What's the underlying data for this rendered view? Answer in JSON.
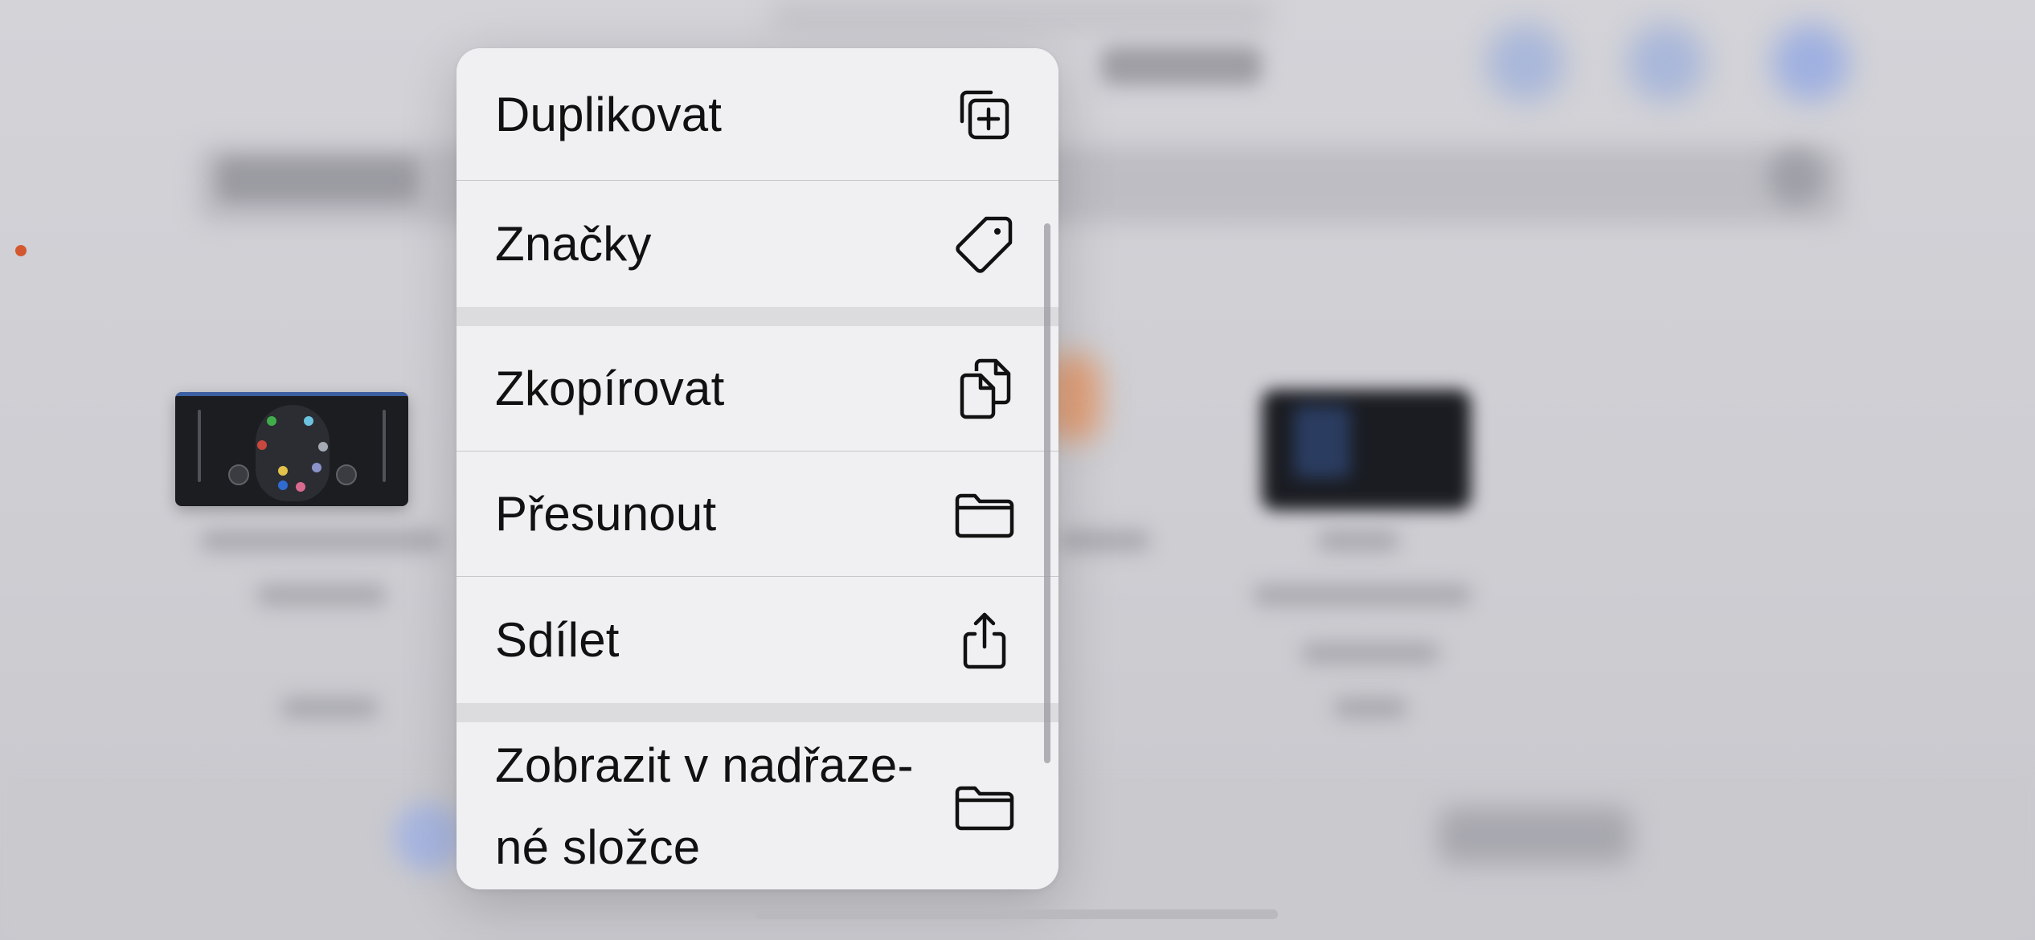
{
  "menu": {
    "items": [
      {
        "label": "Duplikovat",
        "icon": "duplicate-icon"
      },
      {
        "label": "Značky",
        "icon": "tag-icon"
      },
      {
        "label": "Zkopírovat",
        "icon": "copy-icon"
      },
      {
        "label": "Přesunout",
        "icon": "folder-icon"
      },
      {
        "label": "Sdílet",
        "icon": "share-icon"
      },
      {
        "label": "Zobrazit v nadřaze-\nné složce",
        "icon": "folder-icon"
      }
    ]
  },
  "colors": {
    "menu_background": "#f0f0f2",
    "status_dot": "#d4582f"
  }
}
